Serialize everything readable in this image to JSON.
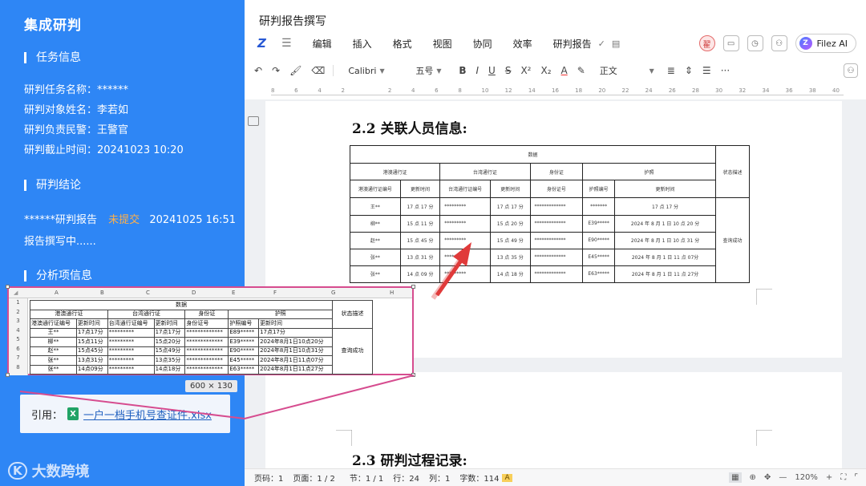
{
  "left_panel": {
    "app_title": "集成研判",
    "task_section": {
      "title": "任务信息",
      "lines": [
        "研判任务名称：******",
        "研判对象姓名：李若如",
        "研判负责民警：王警官",
        "研判截止时间：20241023 10:20"
      ]
    },
    "conclusion_section": {
      "title": "研判结论",
      "report_name": "******研判报告",
      "report_status": "未提交",
      "report_time": "20241025 16:51",
      "writing_status": "报告撰写中......"
    },
    "analysis_section": {
      "title": "分析项信息"
    },
    "citation": {
      "label": "引用：",
      "file_icon": "X",
      "file_name": "一户一档手机号查证件.xlsx"
    },
    "brand": {
      "logo": "K",
      "name": "大数跨境"
    }
  },
  "editor": {
    "doc_title": "研判报告撰写",
    "menu": [
      "编辑",
      "插入",
      "格式",
      "视图",
      "协同",
      "效率",
      "研判报告"
    ],
    "right": {
      "avatar": "翟",
      "filez": "Filez AI"
    },
    "toolbar": {
      "font": "Calibri",
      "size": "五号",
      "style": "正文",
      "buttons": [
        "B",
        "I",
        "U",
        "S",
        "X²",
        "X₂",
        "A"
      ]
    },
    "ruler_ticks": [
      "8",
      "6",
      "4",
      "2",
      "",
      "2",
      "4",
      "6",
      "8",
      "10",
      "12",
      "14",
      "16",
      "18",
      "20",
      "22",
      "24",
      "26",
      "28",
      "30",
      "32",
      "34",
      "36",
      "38",
      "40"
    ],
    "heading_2_2": "2.2 关联人员信息:",
    "heading_2_3": "2.3 研判过程记录:",
    "doc_table": {
      "top": "数据",
      "groups": [
        "港澳通行证",
        "台湾通行证",
        "身份证",
        "护照"
      ],
      "status_header": "状态描述",
      "subheaders": [
        "港澳通行证编号",
        "更新时间",
        "台湾通行证编号",
        "更新时间",
        "身份证号",
        "护照编号",
        "更新时间"
      ],
      "status_value": "查询成功",
      "rows": [
        [
          "王**",
          "17 点 17 分",
          "*********",
          "17 点 17 分",
          "*************",
          "*******",
          "17 点 17 分"
        ],
        [
          "柳**",
          "15 点 11 分",
          "*********",
          "15 点 20 分",
          "*************",
          "E39*****",
          "2024 年 8 月 1 日 10 点 20 分"
        ],
        [
          "赵**",
          "15 点 45 分",
          "*********",
          "15 点 49 分",
          "*************",
          "E90*****",
          "2024 年 8 月 1 日 10 点 31 分"
        ],
        [
          "张**",
          "13 点 31 分",
          "*********",
          "13 点 35 分",
          "*************",
          "E45*****",
          "2024 年 8 月 1 日 11 点 07分"
        ],
        [
          "张**",
          "14 点 09 分",
          "*********",
          "14 点 18 分",
          "*************",
          "E63*****",
          "2024 年 8 月 1 日 11 点 27分"
        ]
      ]
    },
    "statusbar": {
      "page": "页码：1",
      "pages": "页面：1 / 2",
      "section": "节：1 / 1",
      "row": "行：24",
      "col": "列：1",
      "words": "字数：114",
      "badge": "A",
      "zoom": "120%"
    }
  },
  "sheet": {
    "col_headers": [
      "A",
      "B",
      "C",
      "D",
      "E",
      "F",
      "G",
      "H"
    ],
    "row_numbers": [
      "1",
      "2",
      "3",
      "4",
      "5",
      "6",
      "7",
      "8"
    ],
    "top": "数据",
    "groups": [
      "港澳通行证",
      "台湾通行证",
      "身份证",
      "护照"
    ],
    "status_header": "状态描述",
    "subheaders": [
      "港澳通行证编号",
      "更新时间",
      "台湾通行证编号",
      "更新时间",
      "身份证号",
      "护照编号",
      "更新时间"
    ],
    "status_value": "查询成功",
    "rows": [
      [
        "王**",
        "17点17分",
        "*********",
        "17点17分",
        "*************",
        "E89*****",
        "17点17分"
      ],
      [
        "柳**",
        "15点11分",
        "*********",
        "15点20分",
        "*************",
        "E39*****",
        "2024年8月1日10点20分"
      ],
      [
        "赵**",
        "15点45分",
        "*********",
        "15点49分",
        "*************",
        "E90*****",
        "2024年8月1日10点31分"
      ],
      [
        "张**",
        "13点31分",
        "*********",
        "13点35分",
        "*************",
        "E45*****",
        "2024年8月1日11点07分"
      ],
      [
        "张**",
        "14点09分",
        "*********",
        "14点18分",
        "*************",
        "E63*****",
        "2024年8月1日11点27分"
      ]
    ],
    "size_label": "600 × 130"
  },
  "colors": {
    "panel_blue": "#2e86f5",
    "accent_pink": "#d64c8f",
    "pending_orange": "#ffb04a",
    "arrow_red": "#e03a3a"
  }
}
